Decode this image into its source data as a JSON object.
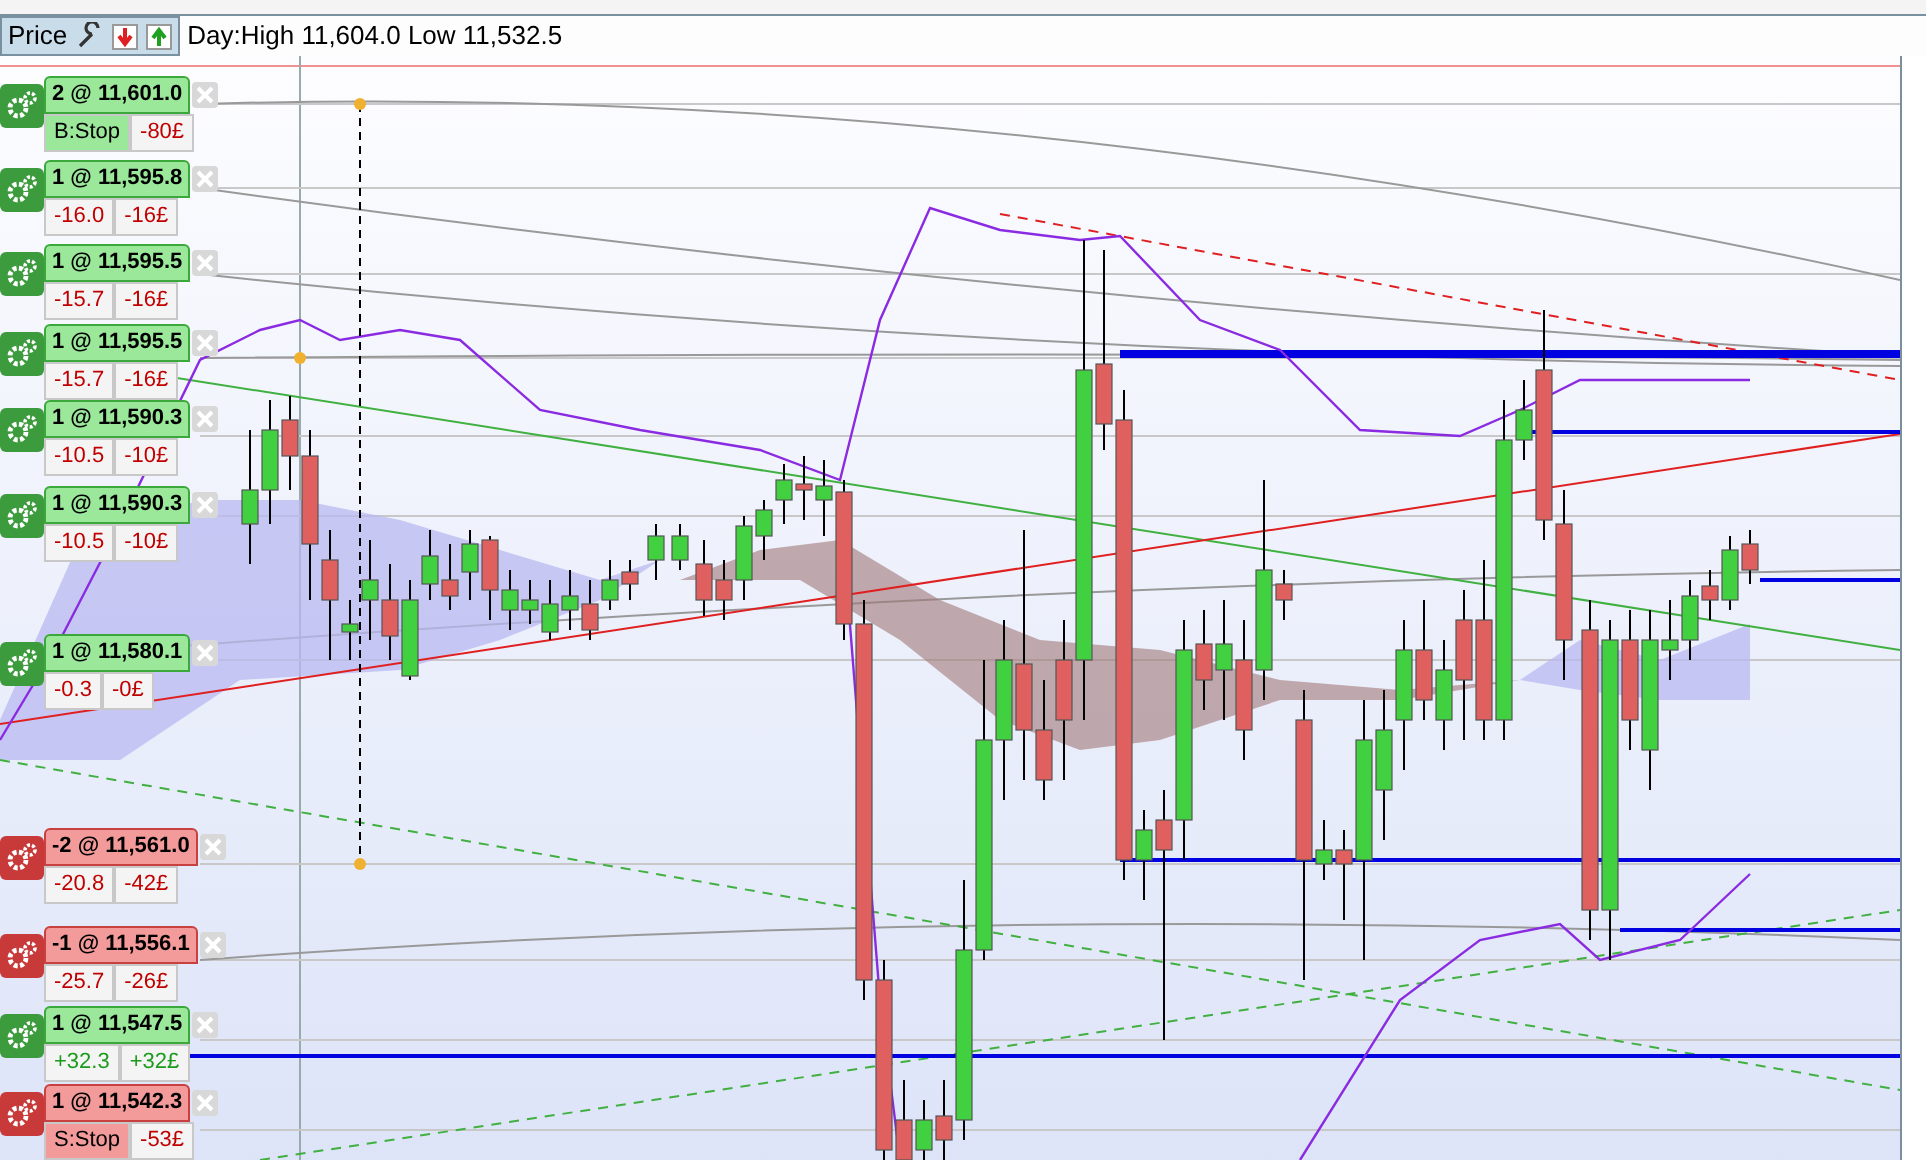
{
  "toolbar": {
    "title": "Price",
    "day_range": "Day:High 11,604.0 Low 11,532.5"
  },
  "orders": [
    {
      "kind": "long",
      "label": "2 @ 11,601.0",
      "cells": [
        {
          "text": "B:Stop",
          "kind": "stop"
        },
        {
          "text": "-80£",
          "kind": "pnl",
          "color": "#c00000"
        }
      ]
    },
    {
      "kind": "long",
      "label": "1 @ 11,595.8",
      "cells": [
        {
          "text": "-16.0",
          "kind": "pnl",
          "color": "#c00000"
        },
        {
          "text": "-16£",
          "kind": "pnl",
          "color": "#c00000"
        }
      ]
    },
    {
      "kind": "long",
      "label": "1 @ 11,595.5",
      "cells": [
        {
          "text": "-15.7",
          "kind": "pnl",
          "color": "#c00000"
        },
        {
          "text": "-16£",
          "kind": "pnl",
          "color": "#c00000"
        }
      ]
    },
    {
      "kind": "long",
      "label": "1 @ 11,595.5",
      "cells": [
        {
          "text": "-15.7",
          "kind": "pnl",
          "color": "#c00000"
        },
        {
          "text": "-16£",
          "kind": "pnl",
          "color": "#c00000"
        }
      ]
    },
    {
      "kind": "long",
      "label": "1 @ 11,590.3",
      "cells": [
        {
          "text": "-10.5",
          "kind": "pnl",
          "color": "#c00000"
        },
        {
          "text": "-10£",
          "kind": "pnl",
          "color": "#c00000"
        }
      ]
    },
    {
      "kind": "long",
      "label": "1 @ 11,590.3",
      "cells": [
        {
          "text": "-10.5",
          "kind": "pnl",
          "color": "#c00000"
        },
        {
          "text": "-10£",
          "kind": "pnl",
          "color": "#c00000"
        }
      ]
    },
    {
      "kind": "long",
      "label": "1 @ 11,580.1",
      "cells": [
        {
          "text": "-0.3",
          "kind": "pnl",
          "color": "#c00000"
        },
        {
          "text": "-0£",
          "kind": "pnl",
          "color": "#c00000"
        }
      ]
    },
    {
      "kind": "short",
      "label": "-2 @ 11,561.0",
      "cells": [
        {
          "text": "-20.8",
          "kind": "pnl",
          "color": "#c00000"
        },
        {
          "text": "-42£",
          "kind": "pnl",
          "color": "#c00000"
        }
      ]
    },
    {
      "kind": "short",
      "label": "-1 @ 11,556.1",
      "cells": [
        {
          "text": "-25.7",
          "kind": "pnl",
          "color": "#c00000"
        },
        {
          "text": "-26£",
          "kind": "pnl",
          "color": "#c00000"
        }
      ]
    },
    {
      "kind": "long",
      "label": "1 @ 11,547.5",
      "cells": [
        {
          "text": "+32.3",
          "kind": "pnl",
          "color": "#1a9a1a"
        },
        {
          "text": "+32£",
          "kind": "pnl",
          "color": "#1a9a1a"
        }
      ]
    },
    {
      "kind": "short",
      "label": "1 @ 11,542.3",
      "cells": [
        {
          "text": "S:Stop",
          "kind": "stop"
        },
        {
          "text": "-53£",
          "kind": "pnl",
          "color": "#c00000"
        }
      ]
    }
  ]
}
